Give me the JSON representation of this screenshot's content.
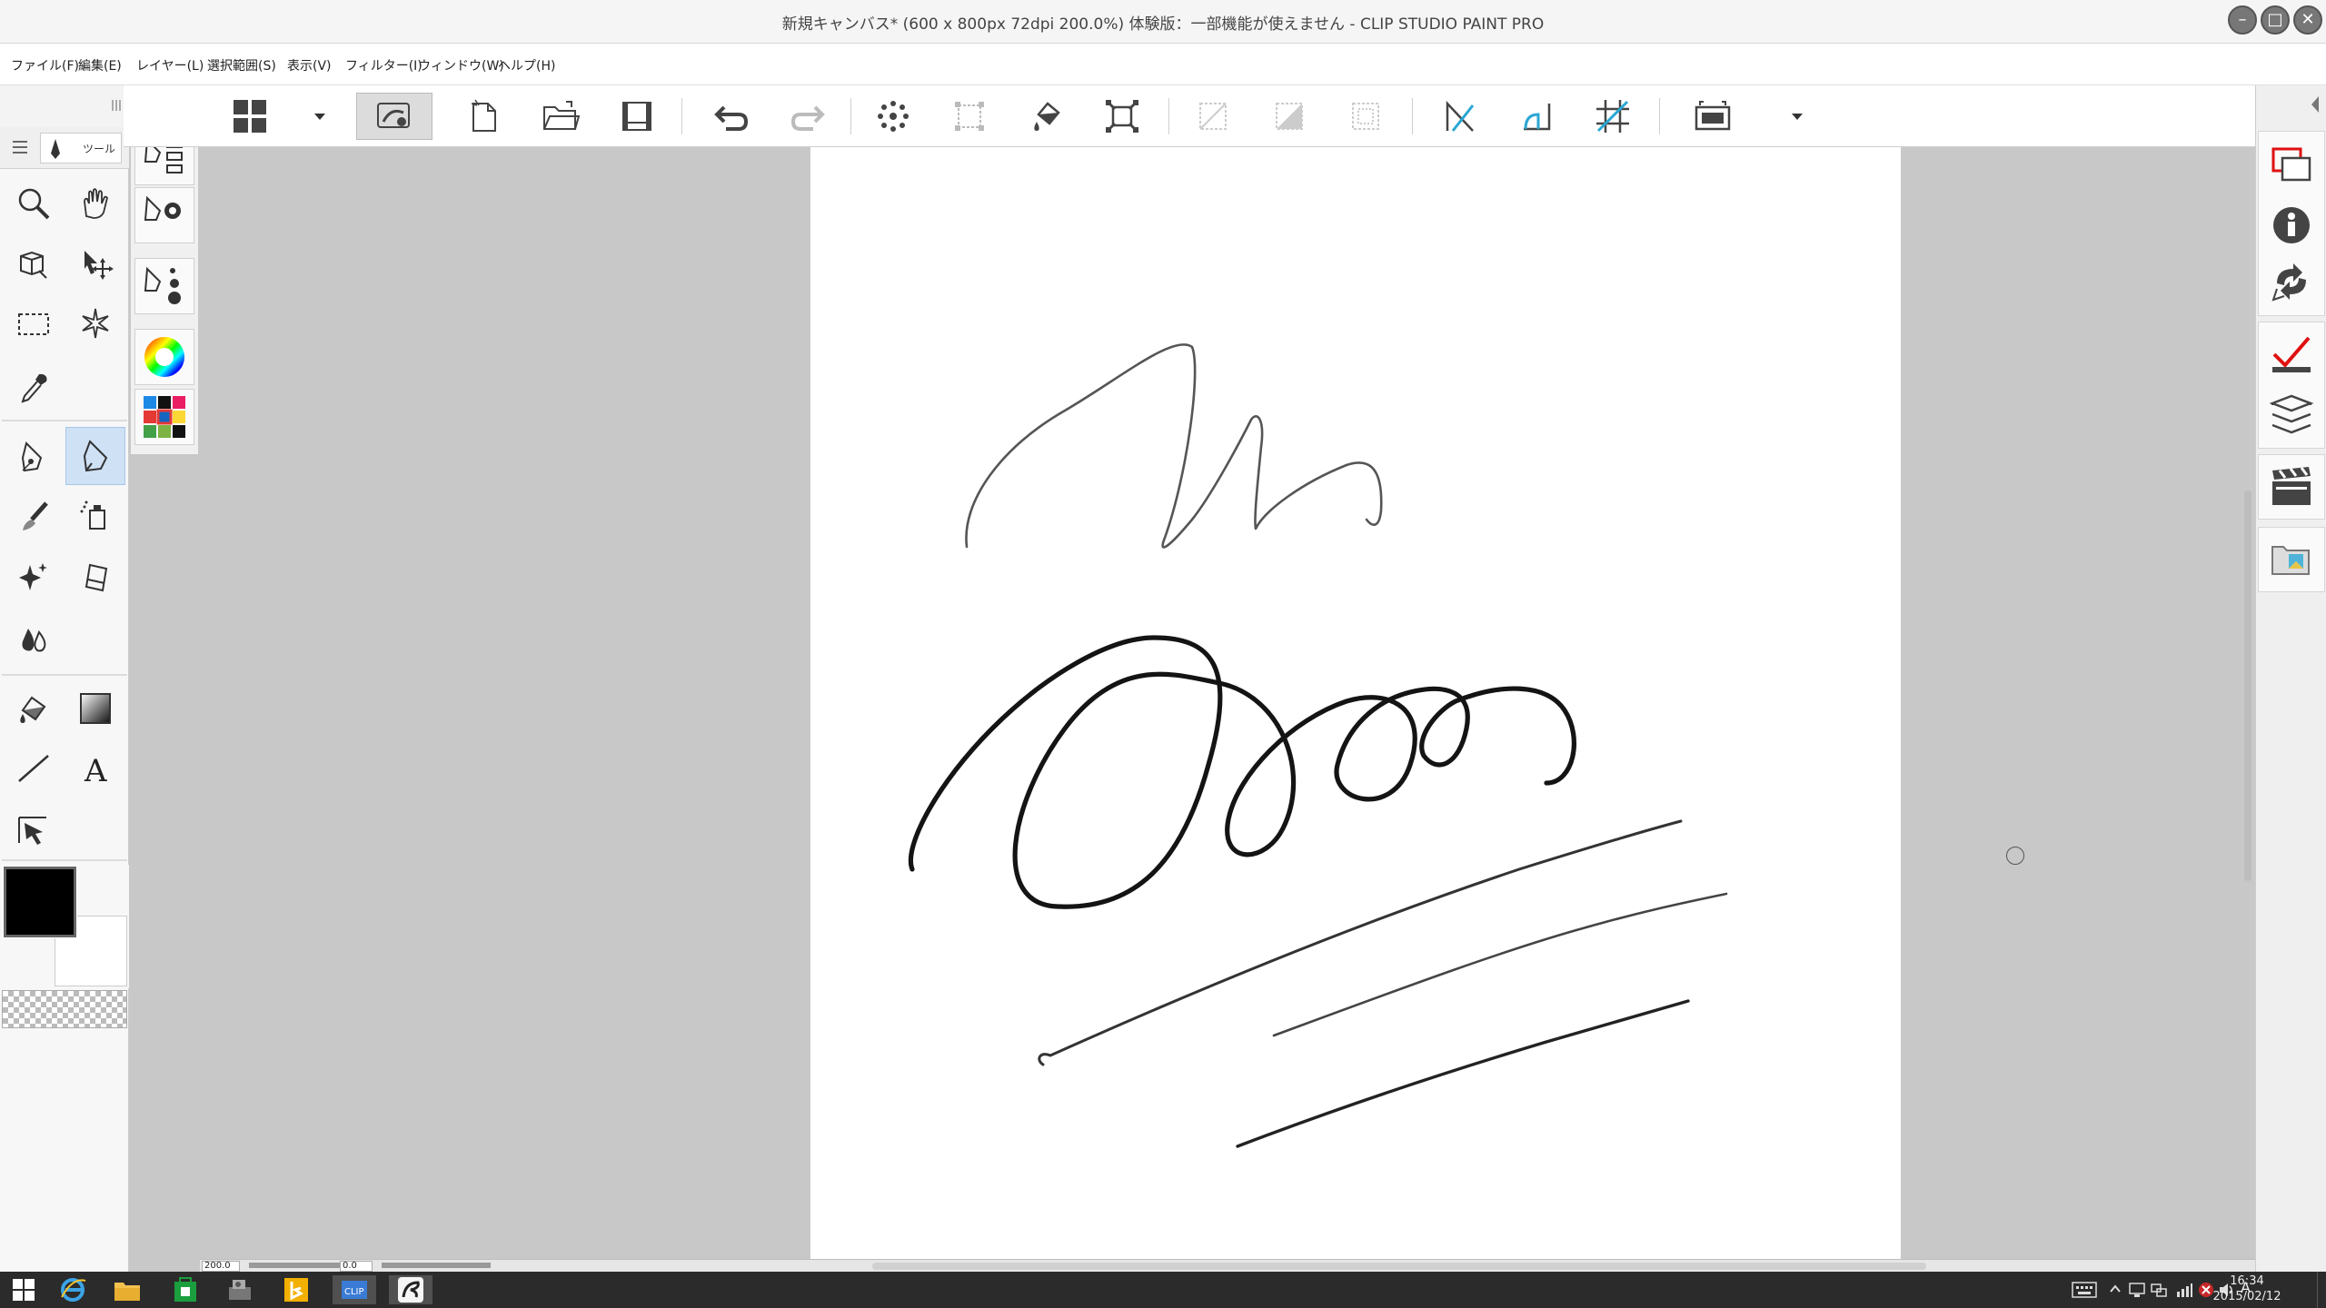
{
  "window": {
    "title": "新規キャンバス* (600 x 800px 72dpi 200.0%)  体験版：一部機能が使えません - CLIP STUDIO PAINT PRO",
    "controls": [
      "minimize-icon",
      "maximize-icon",
      "close-icon"
    ]
  },
  "menu": [
    "ファイル(F)",
    "編集(E)",
    "レイヤー(L)",
    "選択範囲(S)",
    "表示(V)",
    "フィルター(I)",
    "ウィンドウ(W)",
    "ヘルプ(H)"
  ],
  "tool_palette": {
    "tab_label": "ツール",
    "tools": [
      "zoom-icon",
      "hand-icon",
      "camera-icon",
      "move-icon",
      "marquee-icon",
      "magic-wand-icon",
      "eyedropper-icon",
      "pen-icon",
      "pencil-icon",
      "brush-icon",
      "airbrush-icon",
      "decoration-icon",
      "eraser-icon",
      "blend-icon",
      "fill-icon",
      "gradient-icon",
      "line-icon",
      "text-icon",
      "operation-icon"
    ],
    "active_tool": "pencil-icon",
    "main_color": "#000000",
    "sub_color": "#ffffff"
  },
  "command_bar": {
    "buttons": [
      "layout-icon",
      "clip-studio-icon",
      "new-icon",
      "open-icon",
      "save-icon",
      "undo-icon",
      "redo-icon",
      "clear-icon",
      "transform-icon",
      "fill-selection-icon",
      "scale-icon",
      "deselect-icon",
      "invert-selection-icon",
      "show-selection-icon",
      "ruler-snap-icon",
      "special-ruler-snap-icon",
      "grid-snap-icon",
      "fit-view-icon"
    ]
  },
  "status": {
    "zoom": "200.0",
    "rotation": "0.0"
  },
  "taskbar": {
    "time": "16:34",
    "date": "2015/02/12"
  }
}
